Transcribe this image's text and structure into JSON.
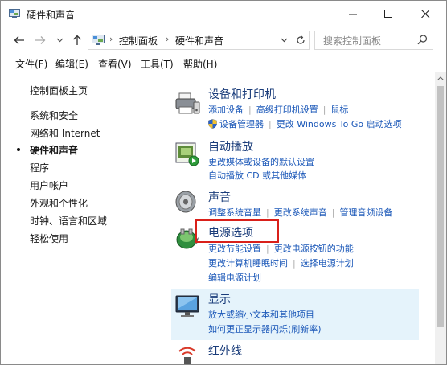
{
  "window": {
    "title": "硬件和声音"
  },
  "address": {
    "crumb1": "控制面板",
    "crumb2": "硬件和声音",
    "separator": "›"
  },
  "search": {
    "placeholder": "搜索控制面板"
  },
  "menu": {
    "items": [
      "文件(F)",
      "编辑(E)",
      "查看(V)",
      "工具(T)",
      "帮助(H)"
    ]
  },
  "sidebar": {
    "home": "控制面板主页",
    "items": [
      "系统和安全",
      "网络和 Internet",
      "硬件和声音",
      "程序",
      "用户帐户",
      "外观和个性化",
      "时钟、语言和区域",
      "轻松使用"
    ],
    "current_index": 2
  },
  "categories": {
    "devices": {
      "title": "设备和打印机",
      "links_row1": [
        "添加设备",
        "高级打印机设置",
        "鼠标"
      ],
      "links_row2": [
        "设备管理器",
        "更改 Windows To Go 启动选项"
      ]
    },
    "autoplay": {
      "title": "自动播放",
      "links_row1": [
        "更改媒体或设备的默认设置"
      ],
      "links_row2": [
        "自动播放 CD 或其他媒体"
      ]
    },
    "sound": {
      "title": "声音",
      "links_row1": [
        "调整系统音量",
        "更改系统声音",
        "管理音频设备"
      ]
    },
    "power": {
      "title": "电源选项",
      "links_row1": [
        "更改节能设置",
        "更改电源按钮的功能"
      ],
      "links_row2": [
        "更改计算机睡眠时间",
        "选择电源计划"
      ],
      "links_row3": [
        "编辑电源计划"
      ]
    },
    "display": {
      "title": "显示",
      "links_row1": [
        "放大或缩小文本和其他项目"
      ],
      "links_row2": [
        "如何更正显示器闪烁(刷新率)"
      ]
    },
    "infrared": {
      "title": "红外线"
    }
  },
  "colors": {
    "link": "#1a57b8",
    "title": "#1a3c7a",
    "highlight": "#d9201a",
    "selected_bg": "#e5f3fb"
  }
}
